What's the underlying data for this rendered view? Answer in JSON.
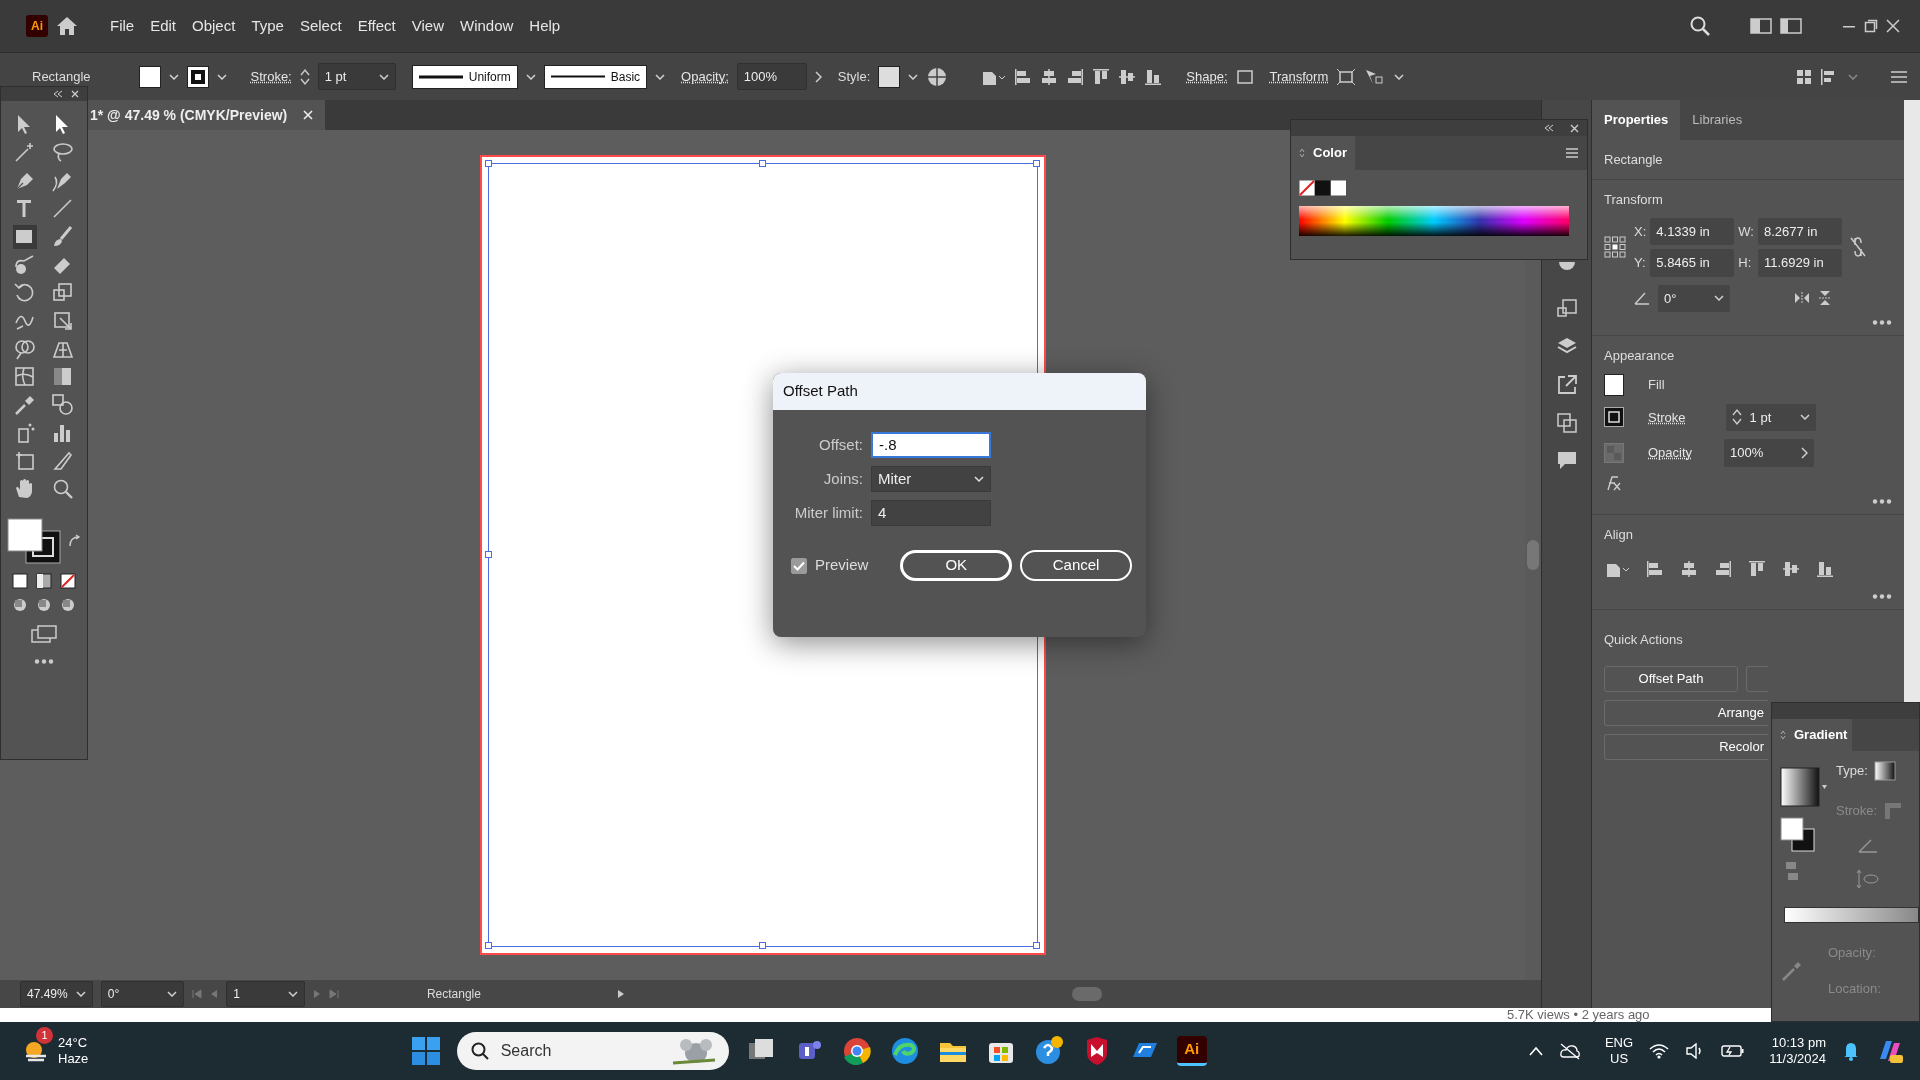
{
  "app": {
    "logo": "Ai"
  },
  "menu_bar": {
    "items": [
      "File",
      "Edit",
      "Object",
      "Type",
      "Select",
      "Effect",
      "View",
      "Window",
      "Help"
    ]
  },
  "control_bar": {
    "object_type": "Rectangle",
    "stroke_label": "Stroke:",
    "stroke_value": "1 pt",
    "profile": "Uniform",
    "brush": "Basic",
    "opacity_label": "Opacity:",
    "opacity_value": "100%",
    "style_label": "Style:",
    "shape_label": "Shape:",
    "transform_label": "Transform"
  },
  "document_tab": {
    "title": "1* @ 47.49 % (CMYK/Preview)"
  },
  "status_bar": {
    "zoom": "47.49%",
    "rotation": "0°",
    "artboard": "1",
    "tool": "Rectangle"
  },
  "dialog": {
    "title": "Offset Path",
    "fields": [
      {
        "kind": "input",
        "label": "Offset:",
        "value": "-.8",
        "focused": true
      },
      {
        "kind": "select",
        "label": "Joins:",
        "value": "Miter",
        "focused": false
      },
      {
        "kind": "input",
        "label": "Miter limit:",
        "value": "4",
        "focused": false
      }
    ],
    "preview": {
      "label": "Preview",
      "checked": true
    },
    "buttons": [
      {
        "label": "OK",
        "default": true
      },
      {
        "label": "Cancel",
        "default": false
      }
    ]
  },
  "color_panel": {
    "title": "Color"
  },
  "properties_panel": {
    "tabs": [
      {
        "label": "Properties",
        "selected": true
      },
      {
        "label": "Libraries",
        "selected": false
      }
    ],
    "object": "Rectangle",
    "transform": {
      "title": "Transform",
      "fields": [
        {
          "label": "X:",
          "value": "4.1339 in"
        },
        {
          "label": "W:",
          "value": "8.2677 in"
        },
        {
          "label": "Y:",
          "value": "5.8465 in"
        },
        {
          "label": "H:",
          "value": "11.6929 in"
        }
      ],
      "angle": "0°"
    },
    "appearance": {
      "title": "Appearance",
      "fill": "Fill",
      "stroke": "Stroke",
      "stroke_value": "1 pt",
      "opacity": "Opacity",
      "opacity_value": "100%"
    },
    "align": {
      "title": "Align"
    },
    "quick_actions": {
      "title": "Quick Actions",
      "buttons": [
        "Offset Path",
        "Arrange",
        "Recolor"
      ]
    }
  },
  "gradient_panel": {
    "title": "Gradient",
    "labels": [
      {
        "label": "Type:",
        "disabled": false
      },
      {
        "label": "Stroke:",
        "disabled": true
      }
    ],
    "bottom_labels": [
      {
        "label": "Opacity:",
        "disabled": true
      },
      {
        "label": "Location:",
        "disabled": true
      }
    ]
  },
  "background_page": {
    "meta": "5.7K views  • 2 years ago"
  },
  "taskbar": {
    "weather": {
      "badge": "1",
      "temperature": "24°C",
      "condition": "Haze"
    },
    "search": {
      "placeholder": "Search"
    },
    "pinned_label": "Ai",
    "language": "ENG",
    "region": "US",
    "time": "10:13 pm",
    "date": "11/3/2024"
  }
}
